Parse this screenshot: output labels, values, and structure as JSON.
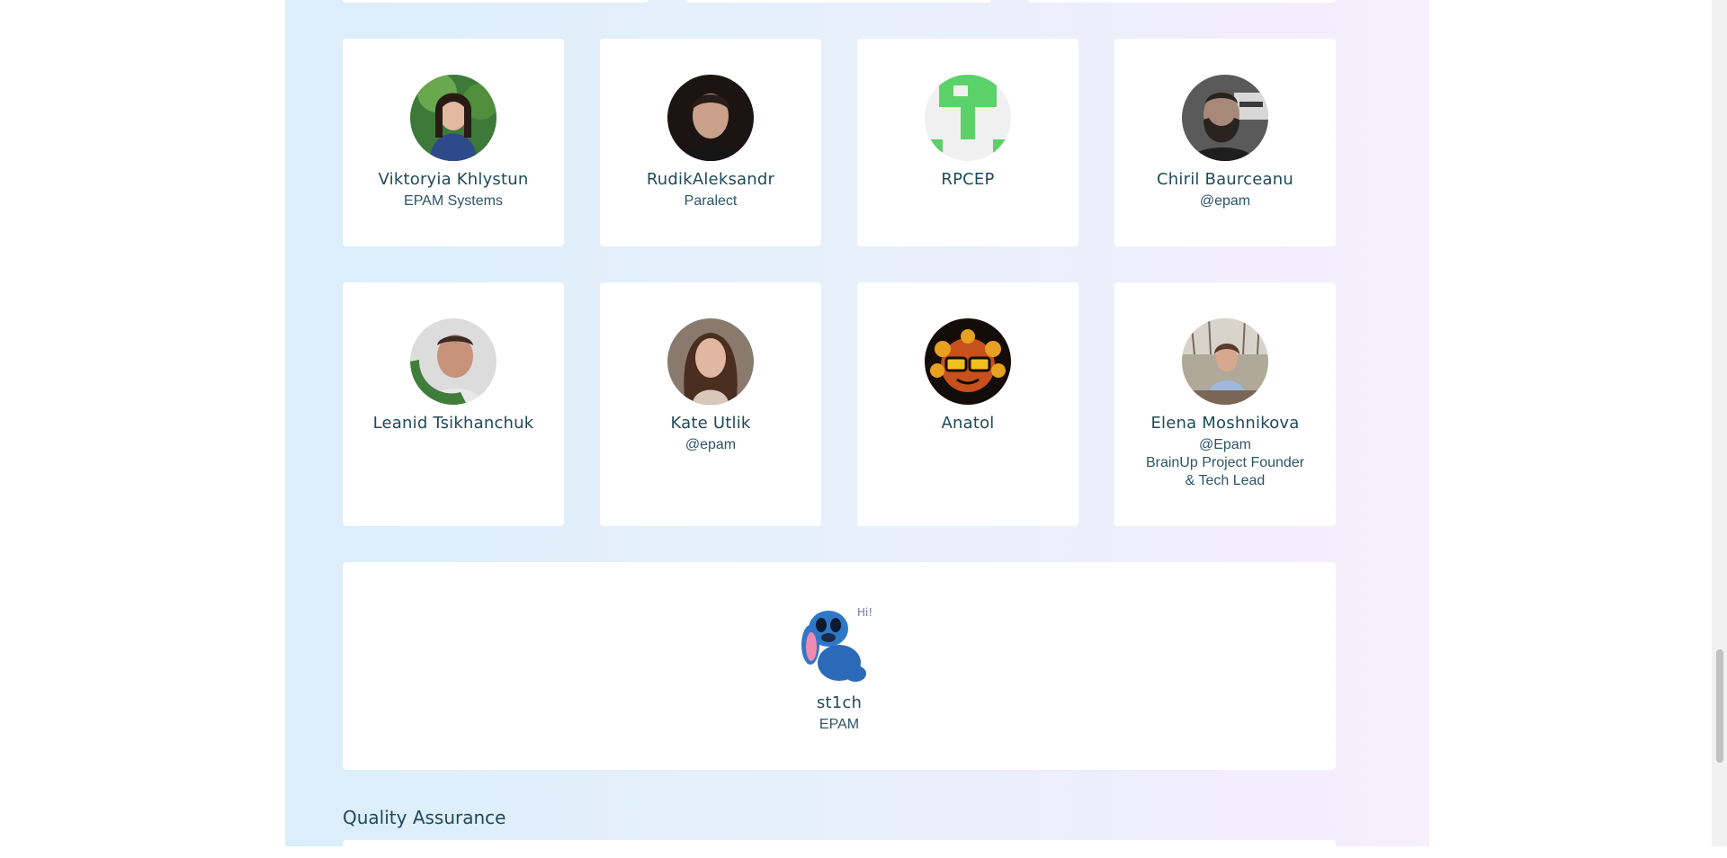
{
  "contributors_row1": [
    {
      "name": "Viktoryia Khlystun",
      "lines": [
        "EPAM Systems"
      ]
    },
    {
      "name": "RudikAleksandr",
      "lines": [
        "Paralect"
      ]
    },
    {
      "name": "RPCEP",
      "lines": []
    },
    {
      "name": "Chiril Baurceanu",
      "lines": [
        "@epam"
      ]
    }
  ],
  "contributors_row2": [
    {
      "name": "Leanid Tsikhanchuk",
      "lines": [],
      "avatar_badge": "#OPENTOWORK"
    },
    {
      "name": "Kate Utlik",
      "lines": [
        "@epam"
      ]
    },
    {
      "name": "Anatol",
      "lines": []
    },
    {
      "name": "Elena Moshnikova",
      "lines": [
        "@Epam",
        "BrainUp Project Founder",
        "& Tech Lead"
      ]
    }
  ],
  "featured": {
    "name": "st1ch",
    "lines": [
      "EPAM"
    ],
    "avatar_caption": "Hi!"
  },
  "section_title": "Quality Assurance",
  "colors": {
    "text": "#1e4a5a",
    "card": "#ffffff",
    "bg_left": "#dbeefb",
    "bg_right": "#f7effc"
  }
}
